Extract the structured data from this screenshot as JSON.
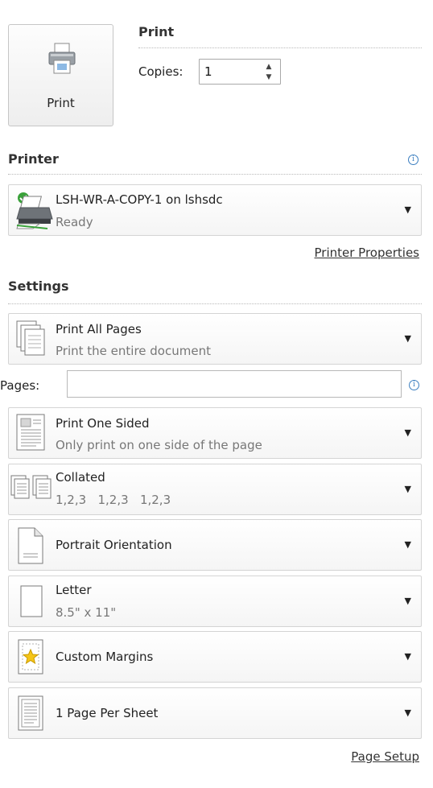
{
  "print_button": {
    "label": "Print",
    "icon": "printer-icon"
  },
  "print_section": {
    "title": "Print",
    "copies_label": "Copies:",
    "copies_value": "1"
  },
  "printer_section": {
    "title": "Printer",
    "selected_printer": {
      "name": "LSH-WR-A-COPY-1 on lshsdc",
      "status": "Ready"
    },
    "properties_link": "Printer Properties"
  },
  "settings": {
    "title": "Settings",
    "pages_label": "Pages:",
    "pages_value": "",
    "items": [
      {
        "title": "Print All Pages",
        "subtitle": "Print the entire document",
        "icon": "pages-stack-icon"
      },
      {
        "title": "Print One Sided",
        "subtitle": "Only print on one side of the page",
        "icon": "one-sided-page-icon"
      },
      {
        "title": "Collated",
        "subtitle": "1,2,3   1,2,3   1,2,3",
        "icon": "collated-pages-icon"
      },
      {
        "title": "Portrait Orientation",
        "subtitle": "",
        "icon": "portrait-page-icon"
      },
      {
        "title": "Letter",
        "subtitle": "8.5\" x 11\"",
        "icon": "paper-size-icon"
      },
      {
        "title": "Custom Margins",
        "subtitle": "",
        "icon": "margins-star-icon"
      },
      {
        "title": "1 Page Per Sheet",
        "subtitle": "",
        "icon": "page-per-sheet-icon"
      }
    ],
    "page_setup_link": "Page Setup"
  },
  "colors": {
    "info_blue": "#3c7fc0",
    "ready_green": "#3aa13a"
  }
}
